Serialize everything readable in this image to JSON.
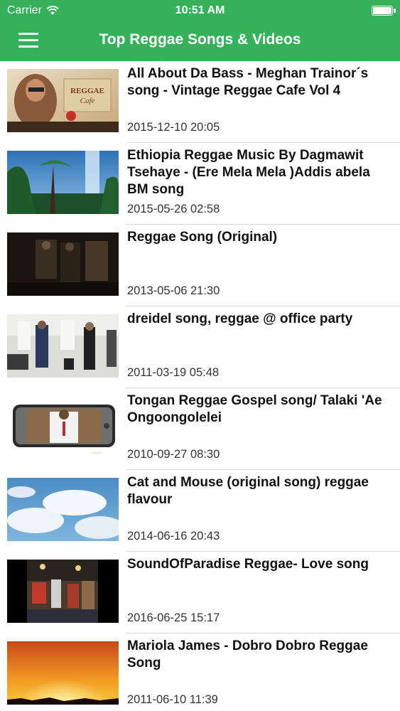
{
  "status_bar": {
    "carrier": "Carrier",
    "time": "10:51 AM"
  },
  "nav": {
    "title": "Top Reggae Songs & Videos",
    "menu_icon": "hamburger-menu-icon",
    "color": "#34b15a"
  },
  "videos": [
    {
      "title": "All About Da Bass - Meghan Trainor´s song - Vintage Reggae Cafe Vol 4",
      "date": "2015-12-10 20:05"
    },
    {
      "title": "Ethiopia Reggae Music By Dagmawit Tsehaye - (Ere Mela Mela )Addis abela BM song",
      "date": "2015-05-26 02:58"
    },
    {
      "title": "Reggae Song (Original)",
      "date": "2013-05-06 21:30"
    },
    {
      "title": "dreidel song, reggae @ office party",
      "date": "2011-03-19 05:48"
    },
    {
      "title": "Tongan Reggae Gospel song/ Talaki 'Ae Ongoongolelei",
      "date": "2010-09-27 08:30"
    },
    {
      "title": "Cat and Mouse (original song) reggae flavour",
      "date": "2014-06-16 20:43"
    },
    {
      "title": "SoundOfParadise Reggae- Love song",
      "date": "2016-06-25 15:17"
    },
    {
      "title": "Mariola James - Dobro Dobro Reggae Song",
      "date": "2011-06-10 11:39"
    }
  ]
}
